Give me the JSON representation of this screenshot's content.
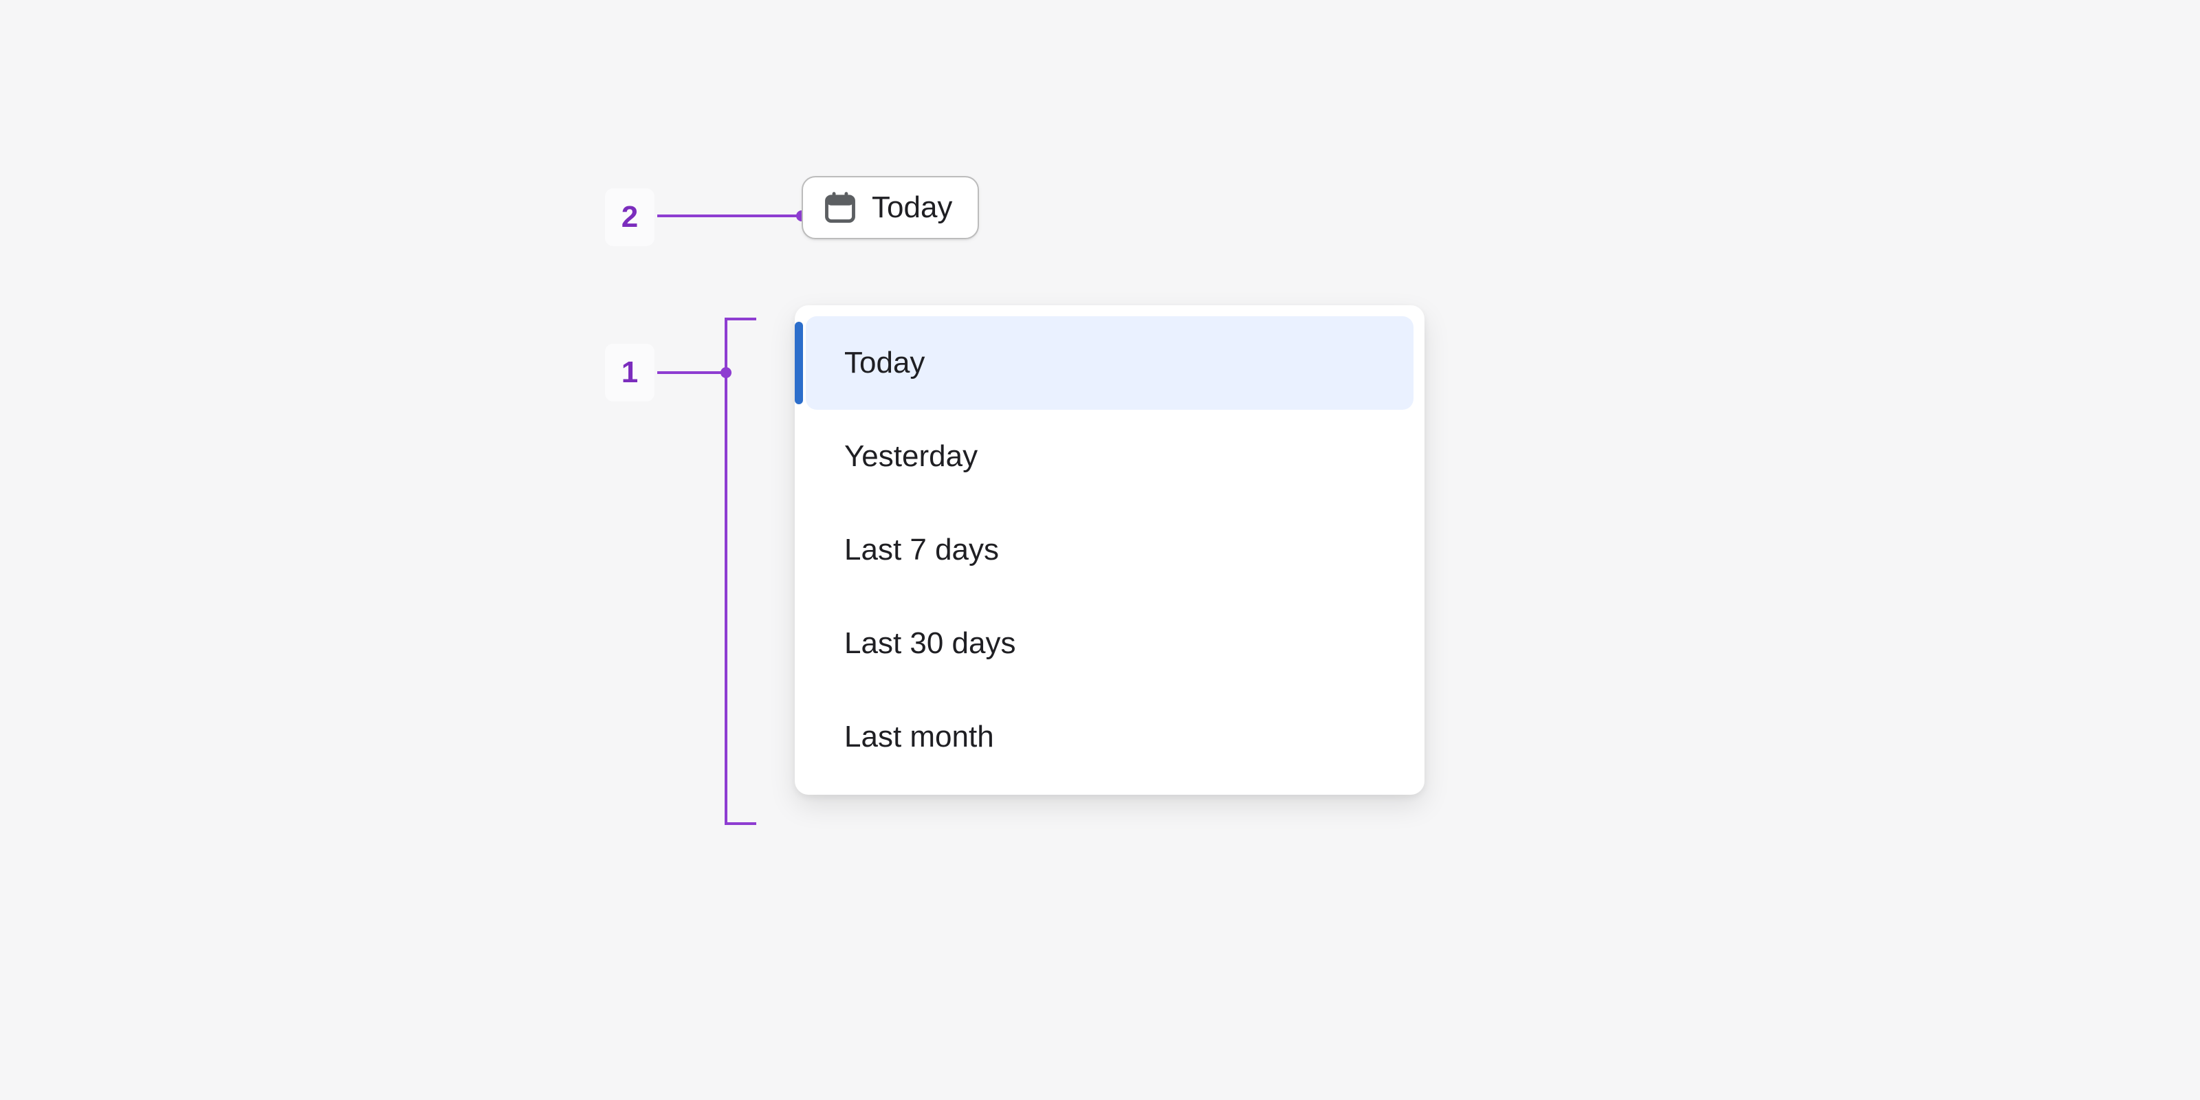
{
  "annotations": {
    "badge1": "1",
    "badge2": "2"
  },
  "activator": {
    "label": "Today"
  },
  "options": [
    {
      "label": "Today",
      "selected": true
    },
    {
      "label": "Yesterday",
      "selected": false
    },
    {
      "label": "Last 7 days",
      "selected": false
    },
    {
      "label": "Last 30 days",
      "selected": false
    },
    {
      "label": "Last month",
      "selected": false
    }
  ],
  "colors": {
    "annotation": "#8e3dd1",
    "selectionAccent": "#2c6ecb",
    "selectionBg": "#eaf1ff",
    "surface": "#ffffff",
    "pageBg": "#f6f6f7"
  }
}
